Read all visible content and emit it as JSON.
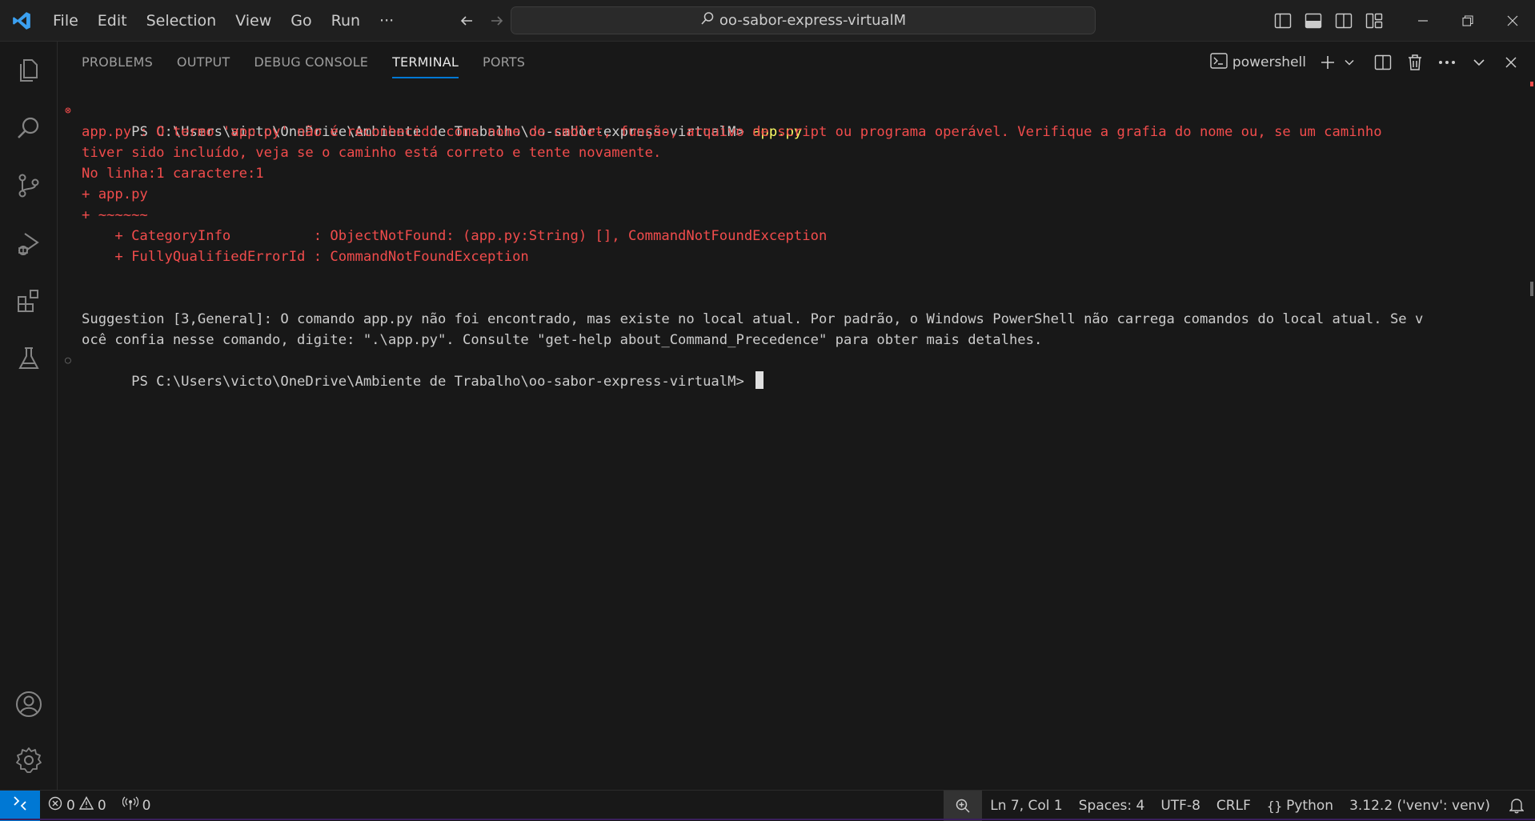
{
  "titlebar": {
    "menu": [
      "File",
      "Edit",
      "Selection",
      "View",
      "Go",
      "Run",
      "···"
    ],
    "search_text": "oo-sabor-express-virtualM"
  },
  "activity": [
    "explorer-icon",
    "search-icon",
    "source-control-icon",
    "run-debug-icon",
    "extensions-icon",
    "testing-icon",
    "accounts-icon",
    "manage-gear-icon"
  ],
  "panel": {
    "tabs": [
      "PROBLEMS",
      "OUTPUT",
      "DEBUG CONSOLE",
      "TERMINAL",
      "PORTS"
    ],
    "active_tab": "TERMINAL",
    "shell": "powershell"
  },
  "terminal": {
    "prompt1": "PS C:\\Users\\victo\\OneDrive\\Ambiente de Trabalho\\oo-sabor-express-virtualM> ",
    "cmd1": "app.py",
    "err1": "app.py : O termo 'app.py' não é reconhecido como nome de cmdlet, função, arquivo de script ou programa operável. Verifique a grafia do nome ou, se um caminho",
    "err2": "tiver sido incluído, veja se o caminho está correto e tente novamente.",
    "err3": "No linha:1 caractere:1",
    "err4": "+ app.py",
    "err5": "+ ~~~~~~",
    "err6": "    + CategoryInfo          : ObjectNotFound: (app.py:String) [], CommandNotFoundException",
    "err7": "    + FullyQualifiedErrorId : CommandNotFoundException",
    "sugg1": "Suggestion [3,General]: O comando app.py não foi encontrado, mas existe no local atual. Por padrão, o Windows PowerShell não carrega comandos do local atual. Se v",
    "sugg2": "ocê confia nesse comando, digite: \".\\app.py\". Consulte \"get-help about_Command_Precedence\" para obter mais detalhes.",
    "prompt2": "PS C:\\Users\\victo\\OneDrive\\Ambiente de Trabalho\\oo-sabor-express-virtualM> "
  },
  "status": {
    "errors": "0",
    "warnings": "0",
    "ports": "0",
    "position": "Ln 7, Col 1",
    "spaces": "Spaces: 4",
    "encoding": "UTF-8",
    "eol": "CRLF",
    "language": "Python",
    "interpreter": "3.12.2 ('venv': venv)"
  },
  "colors": {
    "accent": "#0078d4",
    "error": "#f14c4c",
    "command": "#ffff66"
  }
}
